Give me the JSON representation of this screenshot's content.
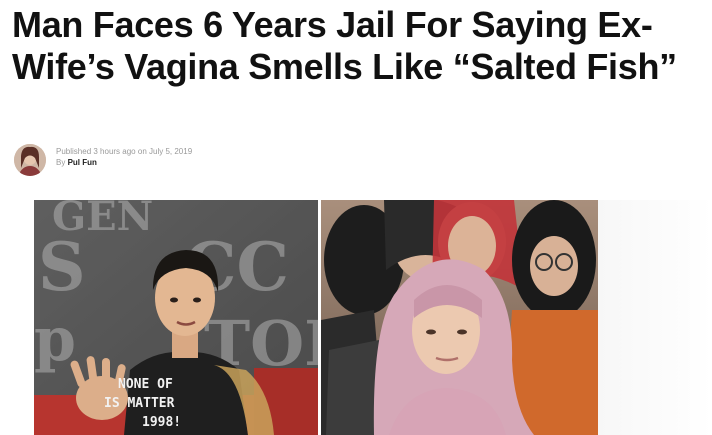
{
  "article": {
    "headline": "Man Faces 6 Years Jail For Saying Ex-Wife’s Vagina Smells Like “Salted Fish”",
    "published_prefix": "Published",
    "published_time": "3 hours ago",
    "published_on": "on",
    "published_date": "July 5, 2019",
    "by_label": "By",
    "author": "Pul Fun"
  },
  "image": {
    "shirt_text_line1": "NONE OF",
    "shirt_text_line2": "IS MATTER",
    "shirt_text_line3": "1998!",
    "backdrop_letters": "GEN S CC TOR"
  },
  "icons": {
    "author_avatar": "author-avatar-icon"
  }
}
